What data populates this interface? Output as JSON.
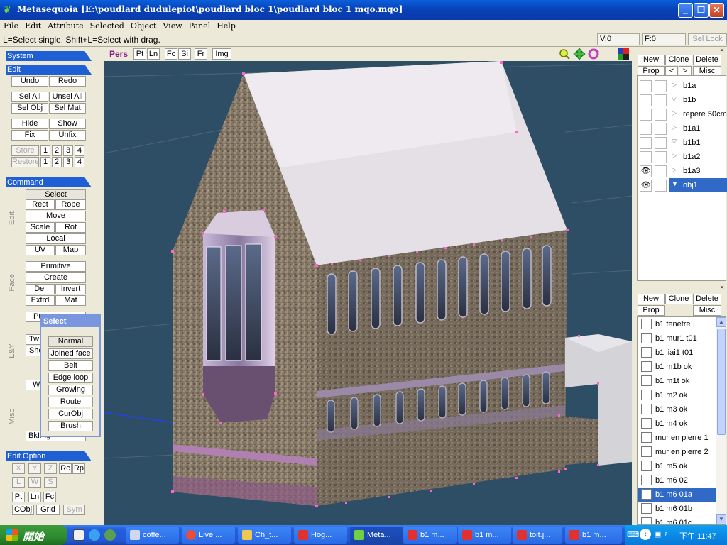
{
  "window": {
    "title": "Metasequoia [E:\\poudlard dudulepiot\\poudlard bloc 1\\poudlard bloc 1 mqo.mqo]",
    "minimize_icon": "minimize-icon",
    "maximize_icon": "maximize-icon",
    "close_icon": "close-icon"
  },
  "menu": [
    "File",
    "Edit",
    "Attribute",
    "Selected",
    "Object",
    "View",
    "Panel",
    "Help"
  ],
  "status": {
    "hint": "L=Select single.  Shift+L=Select with drag.",
    "vertices": "V:0",
    "faces": "F:0",
    "sel_lock": "Sel Lock"
  },
  "left": {
    "system_header": "System",
    "edit_header": "Edit",
    "undo": "Undo",
    "redo": "Redo",
    "sel_all": "Sel All",
    "unsel_all": "Unsel All",
    "sel_obj": "Sel Obj",
    "sel_mat": "Sel Mat",
    "hide": "Hide",
    "show": "Show",
    "fix": "Fix",
    "unfix": "Unfix",
    "store": "Store",
    "restore": "Restore",
    "slots": [
      "1",
      "2",
      "3",
      "4"
    ],
    "command_header": "Command",
    "edit_label": "Edit",
    "select": "Select",
    "rect": "Rect",
    "rope": "Rope",
    "move": "Move",
    "scale": "Scale",
    "rot": "Rot",
    "local": "Local",
    "uv": "UV",
    "map": "Map",
    "face_label": "Face",
    "primitive": "Primitive",
    "create": "Create",
    "del": "Del",
    "invert": "Invert",
    "extrd": "Extrd",
    "mat": "Mat",
    "lsy_label": "L&Y",
    "pu_partial": "Pu",
    "tw_partial": "Tw",
    "she_partial": "She",
    "w_partial": "W",
    "misc_label": "Misc",
    "bkimg_partial": "BkImg",
    "edit_option_header": "Edit Option",
    "x": "X",
    "y": "Y",
    "z": "Z",
    "rc": "Rc",
    "rp": "Rp",
    "l": "L",
    "w": "W",
    "s": "S",
    "pt": "Pt",
    "ln": "Ln",
    "fc": "Fc",
    "cobj": "CObj",
    "grid": "Grid",
    "sym": "Sym"
  },
  "select_popup": {
    "title": "Select",
    "items": [
      "Normal",
      "Joined face",
      "Belt",
      "Edge loop",
      "Growing",
      "Route",
      "CurObj",
      "Brush"
    ]
  },
  "view_toolbar": {
    "pers": "Pers",
    "pt": "Pt",
    "ln": "Ln",
    "fc": "Fc",
    "si": "Si",
    "fr": "Fr",
    "img": "Img",
    "zoom_icon": "zoom-icon",
    "pan_icon": "pan-icon",
    "rotate_icon": "rotate-icon",
    "color_icon": "color-grid-icon"
  },
  "object_panel": {
    "new": "New",
    "clone": "Clone",
    "delete": "Delete",
    "prop": "Prop",
    "prev": "<",
    "next": ">",
    "misc": "Misc",
    "objects": [
      {
        "name": "b1a",
        "visible": false,
        "tri": "▷"
      },
      {
        "name": "b1b",
        "visible": false,
        "tri": "▽"
      },
      {
        "name": "repere 50cm",
        "visible": false,
        "tri": "▷"
      },
      {
        "name": "b1a1",
        "visible": false,
        "tri": "▷"
      },
      {
        "name": "b1b1",
        "visible": false,
        "tri": "▽"
      },
      {
        "name": "b1a2",
        "visible": false,
        "tri": "▷"
      },
      {
        "name": "b1a3",
        "visible": true,
        "tri": "▷"
      },
      {
        "name": "obj1",
        "visible": true,
        "tri": "▼",
        "selected": true
      }
    ]
  },
  "material_panel": {
    "new": "New",
    "clone": "Clone",
    "delete": "Delete",
    "prop": "Prop",
    "misc": "Misc",
    "materials": [
      {
        "name": "b1 fenetre"
      },
      {
        "name": "b1 mur1 t01"
      },
      {
        "name": "b1 liai1 t01"
      },
      {
        "name": "b1 m1b ok"
      },
      {
        "name": "b1 m1t ok"
      },
      {
        "name": "b1 m2 ok"
      },
      {
        "name": "b1 m3 ok"
      },
      {
        "name": "b1 m4 ok"
      },
      {
        "name": "mur en pierre 1"
      },
      {
        "name": "mur en pierre 2"
      },
      {
        "name": "b1 m5 ok"
      },
      {
        "name": "b1 m6 02"
      },
      {
        "name": "b1 m6 01a",
        "selected": true
      },
      {
        "name": "b1 m6 01b"
      },
      {
        "name": "b1 m6 01c"
      }
    ]
  },
  "taskbar": {
    "start": "開始",
    "tasks": [
      {
        "label": "coffe...",
        "color": "#d0d8f0"
      },
      {
        "label": "Live ...",
        "color": "#e84c3d"
      },
      {
        "label": "Ch_t...",
        "color": "#f0c850"
      },
      {
        "label": "Hog...",
        "color": "#e03030"
      },
      {
        "label": "Meta...",
        "color": "#6fd040",
        "active": true
      },
      {
        "label": "b1 m...",
        "color": "#e03030"
      },
      {
        "label": "b1 m...",
        "color": "#e03030"
      },
      {
        "label": "toit.j...",
        "color": "#e03030"
      },
      {
        "label": "b1 m...",
        "color": "#e03030"
      }
    ],
    "clock": "下午 11:47"
  }
}
